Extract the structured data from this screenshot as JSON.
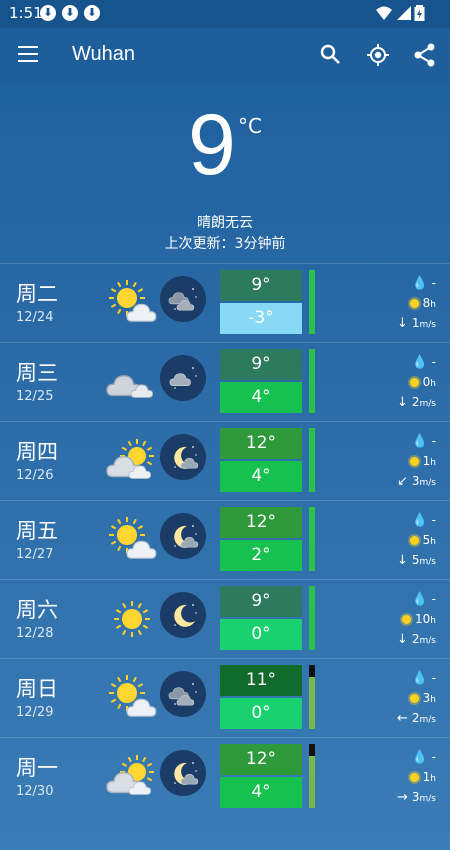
{
  "status_bar": {
    "time": "1:51"
  },
  "app_bar": {
    "city": "Wuhan"
  },
  "current": {
    "temp": "9",
    "unit": "°C",
    "condition": "晴朗无云",
    "updated": "上次更新：3分钟前"
  },
  "days": [
    {
      "day": "周二",
      "date": "12/24",
      "high": "9°",
      "low": "-3°",
      "high_color": "#2e7a5e",
      "low_color": "#87d9f4",
      "bar_color": "#2fc04a",
      "bar_dark": "0",
      "precip": "-",
      "sun": "8",
      "wind_arrow": "↓",
      "wind": "1",
      "day_icon": "sun-cloud",
      "night_icon": "cloud-night"
    },
    {
      "day": "周三",
      "date": "12/25",
      "high": "9°",
      "low": "4°",
      "high_color": "#2e7a5e",
      "low_color": "#16c150",
      "bar_color": "#2fc04a",
      "bar_dark": "0",
      "precip": "-",
      "sun": "0",
      "wind_arrow": "↓",
      "wind": "2",
      "day_icon": "cloud",
      "night_icon": "cloud"
    },
    {
      "day": "周四",
      "date": "12/26",
      "high": "12°",
      "low": "4°",
      "high_color": "#2f9a3c",
      "low_color": "#16c150",
      "bar_color": "#2fc04a",
      "bar_dark": "0",
      "precip": "-",
      "sun": "1",
      "wind_arrow": "↙",
      "wind": "3",
      "day_icon": "cloud-sun",
      "night_icon": "moon-cloud"
    },
    {
      "day": "周五",
      "date": "12/27",
      "high": "12°",
      "low": "2°",
      "high_color": "#2f9a3c",
      "low_color": "#16c150",
      "bar_color": "#2fc04a",
      "bar_dark": "0",
      "precip": "-",
      "sun": "5",
      "wind_arrow": "↓",
      "wind": "5",
      "day_icon": "sun-cloud",
      "night_icon": "moon-cloud"
    },
    {
      "day": "周六",
      "date": "12/28",
      "high": "9°",
      "low": "0°",
      "high_color": "#2e7a5e",
      "low_color": "#19d26f",
      "bar_color": "#2fc04a",
      "bar_dark": "0",
      "precip": "-",
      "sun": "10",
      "wind_arrow": "↓",
      "wind": "2",
      "day_icon": "sun",
      "night_icon": "moon"
    },
    {
      "day": "周日",
      "date": "12/29",
      "high": "11°",
      "low": "0°",
      "high_color": "#116b2d",
      "low_color": "#19d26f",
      "bar_color": "#76ba4c",
      "bar_dark": "12",
      "precip": "-",
      "sun": "3",
      "wind_arrow": "←",
      "wind": "2",
      "day_icon": "sun-cloud",
      "night_icon": "cloud-night"
    },
    {
      "day": "周一",
      "date": "12/30",
      "high": "12°",
      "low": "4°",
      "high_color": "#2f9a3c",
      "low_color": "#16c150",
      "bar_color": "#76ba4c",
      "bar_dark": "12",
      "precip": "-",
      "sun": "1",
      "wind_arrow": "→",
      "wind": "3",
      "day_icon": "cloud-sun",
      "night_icon": "moon-cloud"
    }
  ],
  "units": {
    "sun": "h",
    "wind": "m/s"
  }
}
